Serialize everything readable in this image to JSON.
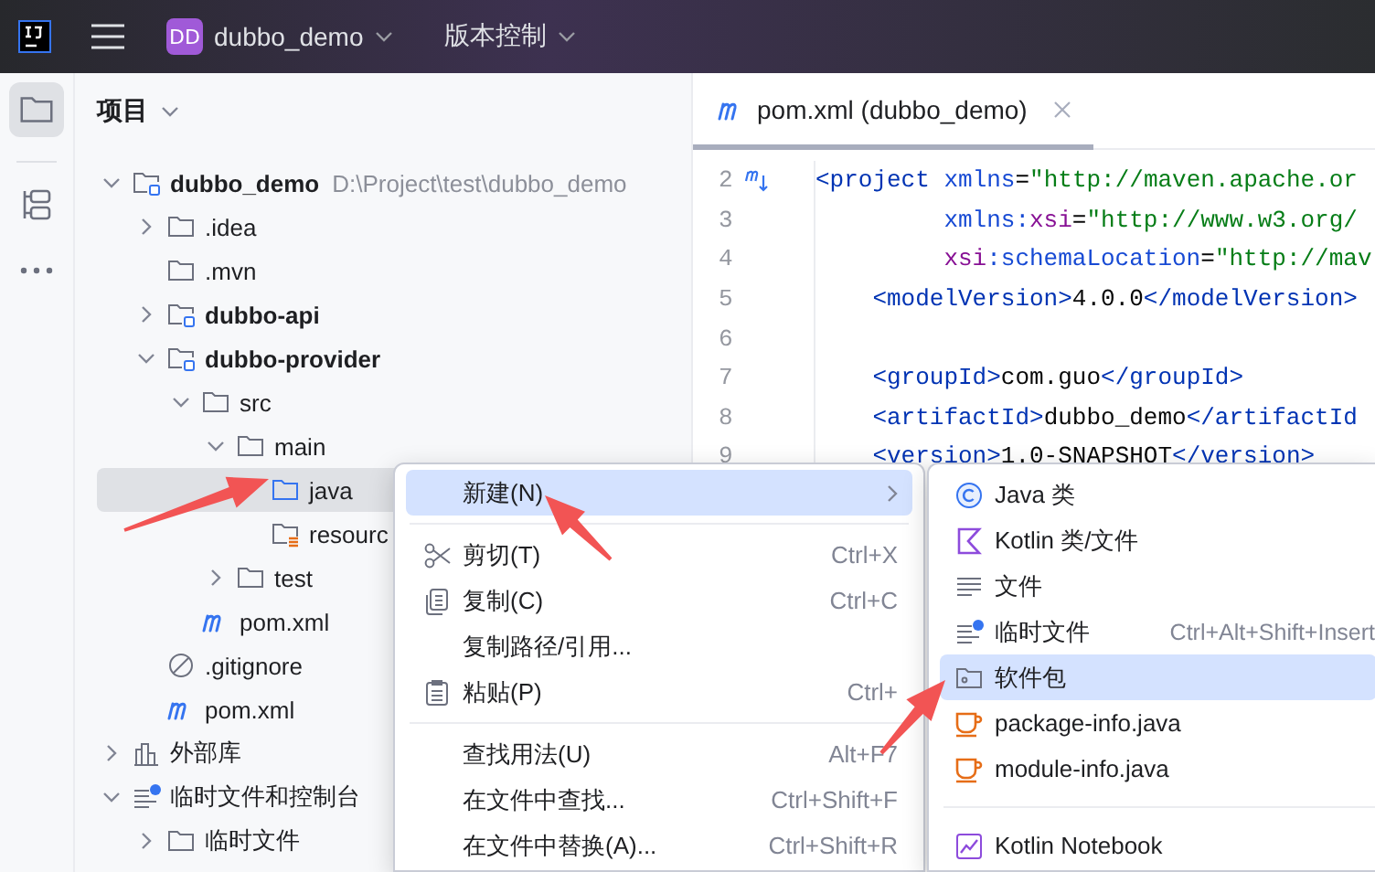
{
  "title_bar": {
    "project_badge": "DD",
    "project": "dubbo_demo",
    "vcs": "版本控制"
  },
  "tool_strip": [
    {
      "kind": "project",
      "selected": true
    },
    {
      "kind": "structure",
      "selected": false
    },
    {
      "kind": "more",
      "selected": false
    }
  ],
  "project_panel": {
    "title": "项目",
    "tree": [
      {
        "label": "dubbo_demo",
        "path": "D:\\Project\\test\\dubbo_demo",
        "kind": "module",
        "expanded": true,
        "selected": false,
        "children": [
          {
            "label": ".idea",
            "kind": "folder",
            "expanded": false,
            "selected": false
          },
          {
            "label": ".mvn",
            "kind": "folder",
            "selected": false
          },
          {
            "label": "dubbo-api",
            "kind": "module",
            "expanded": false,
            "selected": false
          },
          {
            "label": "dubbo-provider",
            "kind": "module",
            "expanded": true,
            "selected": false,
            "children": [
              {
                "label": "src",
                "kind": "folder",
                "expanded": true,
                "selected": false,
                "children": [
                  {
                    "label": "main",
                    "kind": "folder",
                    "expanded": true,
                    "selected": false,
                    "children": [
                      {
                        "label": "java",
                        "kind": "source",
                        "selected": true
                      },
                      {
                        "label": "resourc",
                        "kind": "resource",
                        "selected": false
                      }
                    ]
                  },
                  {
                    "label": "test",
                    "kind": "folder",
                    "expanded": false,
                    "selected": false
                  }
                ]
              },
              {
                "label": "pom.xml",
                "kind": "maven",
                "selected": false
              }
            ]
          },
          {
            "label": ".gitignore",
            "kind": "ignore",
            "selected": false
          },
          {
            "label": "pom.xml",
            "kind": "maven",
            "selected": false
          }
        ]
      },
      {
        "label": "外部库",
        "kind": "library",
        "expanded": false,
        "selected": false
      },
      {
        "label": "临时文件和控制台",
        "kind": "scratch",
        "expanded": true,
        "selected": false,
        "children": [
          {
            "label": "临时文件",
            "kind": "folder",
            "expanded": false,
            "selected": false
          }
        ]
      }
    ]
  },
  "editor": {
    "tabs": [
      {
        "label": "pom.xml (dubbo_demo)",
        "selected": true
      }
    ],
    "lines": [
      {
        "number": "2",
        "kind": "root",
        "gutter_icon": true,
        "tokens": [
          {
            "kind": "tag",
            "text": "<project "
          },
          {
            "kind": "attr",
            "text": "xmlns"
          },
          {
            "kind": "plain",
            "text": "="
          },
          {
            "kind": "str",
            "text": "\"http://maven.apache.or"
          }
        ]
      },
      {
        "number": "3",
        "kind": "attribute",
        "tokens": [
          {
            "kind": "attr",
            "text": "xmlns:"
          },
          {
            "kind": "ns",
            "text": "xsi"
          },
          {
            "kind": "plain",
            "text": "="
          },
          {
            "kind": "str",
            "text": "\"http://www.w3.org/"
          }
        ]
      },
      {
        "number": "4",
        "kind": "attribute",
        "tokens": [
          {
            "kind": "ns",
            "text": "xsi"
          },
          {
            "kind": "attr",
            "text": ":schemaLocation"
          },
          {
            "kind": "plain",
            "text": "="
          },
          {
            "kind": "str",
            "text": "\"http://mav"
          }
        ]
      },
      {
        "number": "5",
        "kind": "element",
        "tokens": [
          {
            "kind": "tag",
            "text": "<modelVersion>"
          },
          {
            "kind": "plain",
            "text": "4.0.0"
          },
          {
            "kind": "tag",
            "text": "</modelVersion>"
          }
        ]
      },
      {
        "number": "6",
        "kind": "blank"
      },
      {
        "number": "7",
        "kind": "element",
        "tokens": [
          {
            "kind": "tag",
            "text": "<groupId>"
          },
          {
            "kind": "plain",
            "text": "com.guo"
          },
          {
            "kind": "tag",
            "text": "</groupId>"
          }
        ]
      },
      {
        "number": "8",
        "kind": "element",
        "tokens": [
          {
            "kind": "tag",
            "text": "<artifactId>"
          },
          {
            "kind": "plain",
            "text": "dubbo_demo"
          },
          {
            "kind": "tag",
            "text": "</artifactId"
          }
        ]
      },
      {
        "number": "9",
        "kind": "element",
        "tokens": [
          {
            "kind": "tag",
            "text": "<version>"
          },
          {
            "kind": "plain",
            "text": "1.0-SNAPSHOT"
          },
          {
            "kind": "tag",
            "text": "</version>"
          }
        ]
      }
    ]
  },
  "context_menu": [
    {
      "kind": "submenu",
      "label": "新建(N)",
      "selected": true
    },
    {
      "kind": "separator"
    },
    {
      "kind": "cut",
      "label": "剪切(T)",
      "shortcut": "Ctrl+X",
      "selected": false
    },
    {
      "kind": "copy",
      "label": "复制(C)",
      "shortcut": "Ctrl+C",
      "selected": false
    },
    {
      "kind": "plain",
      "label": "复制路径/引用...",
      "selected": false
    },
    {
      "kind": "paste",
      "label": "粘贴(P)",
      "shortcut": "Ctrl+",
      "selected": false
    },
    {
      "kind": "separator"
    },
    {
      "kind": "plain",
      "label": "查找用法(U)",
      "shortcut": "Alt+F7",
      "selected": false
    },
    {
      "kind": "plain",
      "label": "在文件中查找...",
      "shortcut": "Ctrl+Shift+F",
      "selected": false
    },
    {
      "kind": "plain",
      "label": "在文件中替换(A)...",
      "shortcut": "Ctrl+Shift+R",
      "selected": false
    }
  ],
  "submenu": [
    {
      "kind": "java-class",
      "label": "Java 类",
      "selected": false
    },
    {
      "kind": "kotlin",
      "label": "Kotlin 类/文件",
      "selected": false
    },
    {
      "kind": "file",
      "label": "文件",
      "selected": false
    },
    {
      "kind": "scratch",
      "label": "临时文件",
      "shortcut": "Ctrl+Alt+Shift+Insert",
      "selected": false
    },
    {
      "kind": "package",
      "label": "软件包",
      "selected": true
    },
    {
      "kind": "cup",
      "label": "package-info.java",
      "selected": false
    },
    {
      "kind": "cup",
      "label": "module-info.java",
      "selected": false
    },
    {
      "kind": "separator"
    },
    {
      "kind": "notebook",
      "label": "Kotlin Notebook",
      "selected": false
    }
  ],
  "annotations": [
    {
      "kind": "arrow"
    },
    {
      "kind": "arrow"
    },
    {
      "kind": "arrow"
    }
  ]
}
